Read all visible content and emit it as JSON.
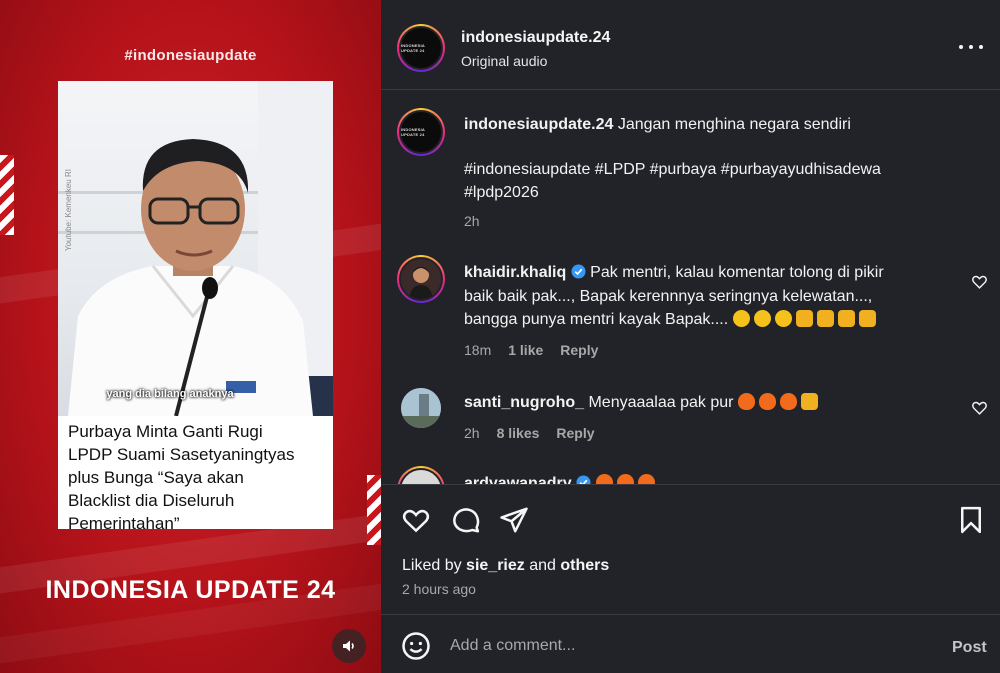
{
  "media": {
    "hashtag_overlay": "#indonesiaupdate",
    "caption_overlay": "yang dia bilang anaknya",
    "watermark": "Youtube: Kemenkeu RI",
    "headline_lines": [
      "Purbaya Minta Ganti Rugi",
      "LPDP Suami Sasetyaningtyas",
      "plus Bunga “Saya akan",
      "Blacklist dia Diseluruh",
      "Pemerintahan”"
    ],
    "brand_text": "INDONESIA UPDATE 24",
    "brand_color": "#c8161d",
    "audio_icon": "speaker-icon"
  },
  "header": {
    "username": "indonesiaupdate.24",
    "subtitle": "Original audio",
    "avatar_text": "INDONESIA UPDATE 24",
    "more_icon": "more-horizontal-icon"
  },
  "caption": {
    "username": "indonesiaupdate.24",
    "text": "Jangan menghina negara sendiri",
    "hashtags_line1": "#indonesiaupdate #LPDP #purbaya #purbayayudhisadewa",
    "hashtags_line2": "#lpdp2026",
    "time": "2h"
  },
  "comments": [
    {
      "username": "khaidir.khaliq",
      "verified": true,
      "text_line1": "Pak mentri, kalau komentar tolong di pikir",
      "text_line2": "baik baik pak..., Bapak kerennnya seringnya kelewatan...,",
      "text_line3": "bangga punya mentri kayak Bapak....",
      "emojis": [
        "star-struck",
        "star-struck",
        "star-struck",
        "thumbs-up",
        "thumbs-up",
        "thumbs-up",
        "thumbs-up"
      ],
      "time": "18m",
      "likes": "1 like",
      "reply": "Reply"
    },
    {
      "username": "santi_nugroho_",
      "verified": false,
      "text_line1": "Menyaaalaa pak pur",
      "emojis": [
        "fire",
        "fire",
        "fire",
        "raising-hands"
      ],
      "time": "2h",
      "likes": "8 likes",
      "reply": "Reply"
    },
    {
      "username": "ardyawanadry",
      "verified": true,
      "emojis": [
        "fire",
        "fire",
        "fire"
      ]
    }
  ],
  "actions": {
    "like_icon": "heart-icon",
    "comment_icon": "comment-icon",
    "share_icon": "send-icon",
    "save_icon": "bookmark-icon",
    "liked_by_prefix": "Liked by",
    "liked_by_user": "sie_riez",
    "liked_by_and": "and",
    "liked_by_others": "others",
    "time_ago": "2 hours ago"
  },
  "add_comment": {
    "placeholder": "Add a comment...",
    "post_label": "Post",
    "emoji_icon": "smiley-icon"
  },
  "colors": {
    "panel_bg": "#212328",
    "hashtag": "#9fb6ff",
    "verified": "#3897f0"
  }
}
